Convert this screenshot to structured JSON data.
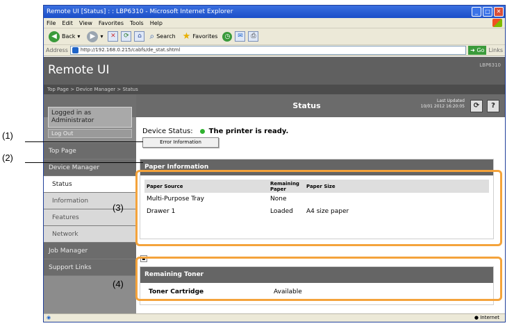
{
  "window": {
    "title": "Remote UI [Status] : : LBP6310 - Microsoft Internet Explorer"
  },
  "menu": [
    "File",
    "Edit",
    "View",
    "Favorites",
    "Tools",
    "Help"
  ],
  "toolbar": {
    "back": "Back",
    "search": "Search",
    "favorites": "Favorites"
  },
  "address": {
    "label": "Address",
    "value": "http://192.168.0.215/cabfs/de_stat.shtml",
    "go": "Go",
    "links": "Links"
  },
  "header": {
    "logo": "Remote UI",
    "model": "LBP6310"
  },
  "breadcrumb": "Top Page > Device Manager > Status",
  "sidebar": {
    "login_line1": "Logged in as",
    "login_line2": "Administrator",
    "logout": "Log Out",
    "items": [
      {
        "label": "Top Page",
        "type": "dark"
      },
      {
        "label": "Device Manager",
        "type": "dark"
      },
      {
        "label": "Status",
        "type": "sub-active"
      },
      {
        "label": "Information",
        "type": "sub"
      },
      {
        "label": "Features",
        "type": "sub"
      },
      {
        "label": "Network",
        "type": "sub"
      },
      {
        "label": "Job Manager",
        "type": "dark"
      },
      {
        "label": "Support Links",
        "type": "dark"
      }
    ]
  },
  "page": {
    "title": "Status",
    "last_updated_label": "Last Updated",
    "last_updated_value": "10/01 2012 16:20:05",
    "refresh_icon": "refresh-icon",
    "help_label": "?",
    "device_status_label": "Device Status:",
    "device_status_value": "The printer is ready.",
    "status_color": "#2fb12f",
    "error_button": "Error Information"
  },
  "paper": {
    "title": "Paper Information",
    "headers": [
      "Paper Source",
      "Remaining Paper",
      "Paper Size"
    ],
    "rows": [
      [
        "Multi-Purpose Tray",
        "None",
        ""
      ],
      [
        "Drawer 1",
        "Loaded",
        "A4 size paper"
      ]
    ]
  },
  "toner": {
    "title": "Remaining Toner",
    "name": "Toner Cartridge",
    "value": "Available"
  },
  "statusbar": {
    "zone": "Internet"
  },
  "callouts": [
    "(1)",
    "(2)",
    "(3)",
    "(4)"
  ],
  "highlight_color": "#f4a33b"
}
